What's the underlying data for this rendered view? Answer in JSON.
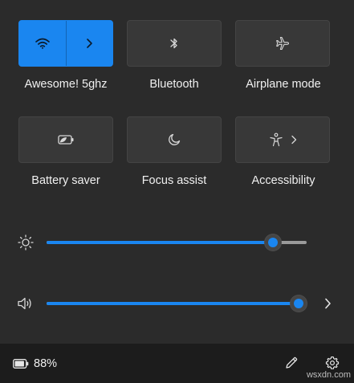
{
  "tiles": {
    "wifi": {
      "label": "Awesome! 5ghz",
      "active": true
    },
    "bluetooth": {
      "label": "Bluetooth"
    },
    "airplane": {
      "label": "Airplane mode"
    },
    "battery_saver": {
      "label": "Battery saver"
    },
    "focus_assist": {
      "label": "Focus assist"
    },
    "accessibility": {
      "label": "Accessibility"
    }
  },
  "sliders": {
    "brightness": {
      "value": 0.87
    },
    "volume": {
      "value": 1.0
    }
  },
  "footer": {
    "battery_percent": "88%",
    "battery_level": 0.88
  },
  "watermark": "wsxdn.com",
  "colors": {
    "accent": "#1a86f0",
    "panel": "#2b2b2b",
    "footer": "#1c1c1c",
    "tile": "#383838"
  }
}
